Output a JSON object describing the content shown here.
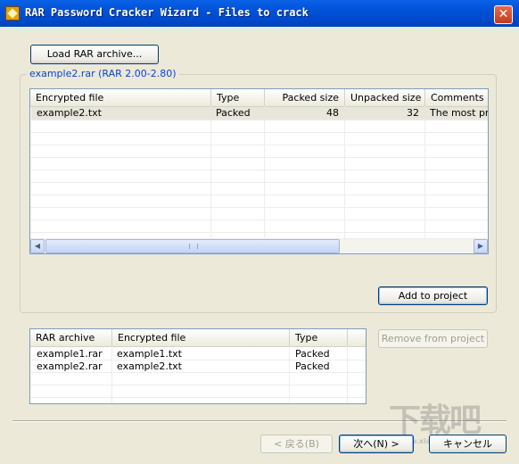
{
  "window": {
    "title": "RAR Password Cracker Wizard - Files to crack",
    "close_glyph": "✕"
  },
  "load_button_label": "Load RAR archive...",
  "group": {
    "label": "example2.rar (RAR 2.00-2.80)"
  },
  "files_table": {
    "columns": [
      "Encrypted file",
      "Type",
      "Packed size",
      "Unpacked size",
      "Comments"
    ],
    "rows": [
      {
        "file": "example2.txt",
        "type": "Packed",
        "packed": "48",
        "unpacked": "32",
        "comments": "The most prefe"
      }
    ]
  },
  "add_button_label": "Add to project",
  "remove_button_label": "Remove from project",
  "project_table": {
    "columns": [
      "RAR archive",
      "Encrypted file",
      "Type"
    ],
    "rows": [
      {
        "archive": "example1.rar",
        "file": "example1.txt",
        "type": "Packed"
      },
      {
        "archive": "example2.rar",
        "file": "example2.txt",
        "type": "Packed"
      }
    ]
  },
  "nav": {
    "back_label": "< 戻る(B)",
    "next_label": "次へ(N) >",
    "cancel_label": "キャンセル"
  },
  "scrollbar": {
    "left_arrow": "◀",
    "right_arrow": "▶"
  },
  "colors": {
    "titlebar": "#0051D6",
    "group_label": "#0046D5",
    "dialog_bg": "#ECE9D8"
  }
}
